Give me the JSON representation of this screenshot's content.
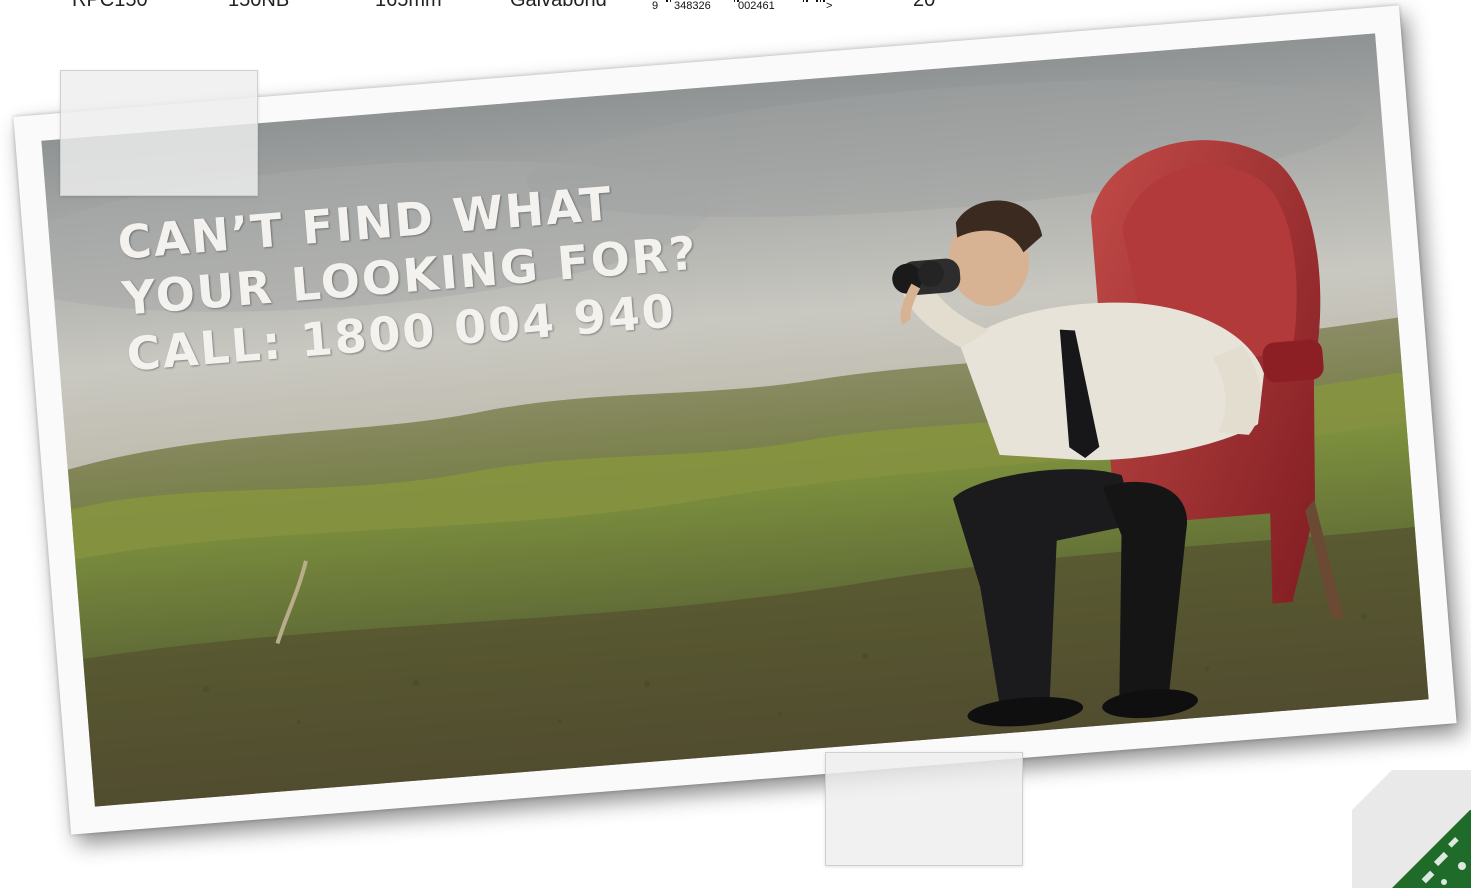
{
  "product_row": {
    "code": "RPC150",
    "size": "150NB",
    "diameter": "165mm",
    "finish": "Galvabond",
    "barcode": {
      "lead_digit": "9",
      "left_group": "348326",
      "right_group": "002461",
      "arrow": ">"
    },
    "quantity": "20"
  },
  "banner": {
    "headline_line1": "CAN’T FIND WHAT",
    "headline_line2": "YOUR LOOKING FOR?",
    "headline_line3": "CALL: 1800 004 940"
  },
  "colors": {
    "headline_text": "#f4f2ee",
    "chair_red": "#a8242a",
    "grass_green": "#7e8f3f",
    "badge_green": "#1f6b2a"
  }
}
